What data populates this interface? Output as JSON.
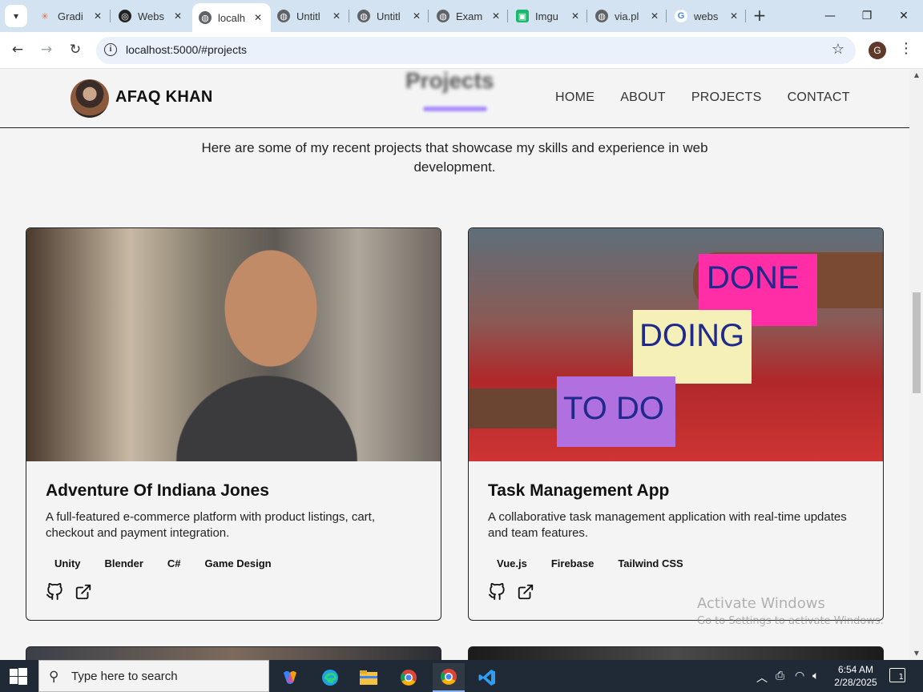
{
  "browser": {
    "tabs": [
      {
        "label": "Gradi",
        "icon": "sparkle-icon",
        "active": false
      },
      {
        "label": "Webs",
        "icon": "openai-icon",
        "active": false
      },
      {
        "label": "localh",
        "icon": "globe-icon",
        "active": true
      },
      {
        "label": "Untitl",
        "icon": "globe-icon",
        "active": false
      },
      {
        "label": "Untitl",
        "icon": "globe-icon",
        "active": false
      },
      {
        "label": "Exam",
        "icon": "globe-icon",
        "active": false
      },
      {
        "label": "Imgu",
        "icon": "imgur-icon",
        "active": false
      },
      {
        "label": "via.pl",
        "icon": "globe-icon",
        "active": false
      },
      {
        "label": "webs",
        "icon": "google-icon",
        "active": false
      }
    ],
    "url": "localhost:5000/#projects",
    "profile_initial": "G"
  },
  "site": {
    "brand": "AFAQ KHAN",
    "section_title": "Projects",
    "nav": [
      "HOME",
      "ABOUT",
      "PROJECTS",
      "CONTACT"
    ],
    "intro": "Here are some of my recent projects that showcase my skills and experience in web development."
  },
  "projects": [
    {
      "title": "Adventure Of Indiana Jones",
      "description": "A full-featured e-commerce platform with product listings, cart, checkout and payment integration.",
      "tags": [
        "Unity",
        "Blender",
        "C#",
        "Game Design"
      ]
    },
    {
      "title": "Task Management App",
      "description": "A collaborative task management application with real-time updates and team features.",
      "tags": [
        "Vue.js",
        "Firebase",
        "Tailwind CSS"
      ],
      "image_notes": [
        "DONE",
        "DOING",
        "TO DO"
      ]
    }
  ],
  "watermark": {
    "line1": "Activate Windows",
    "line2": "Go to Settings to activate Windows."
  },
  "taskbar": {
    "search_placeholder": "Type here to search",
    "time": "6:54 AM",
    "date": "2/28/2025",
    "notification_count": "1"
  },
  "colors": {
    "tabstrip": "#d3e3f1",
    "page_bg": "#f4f4f5",
    "accent_underline": "#a78bfa",
    "taskbar": "#1f2a36"
  }
}
